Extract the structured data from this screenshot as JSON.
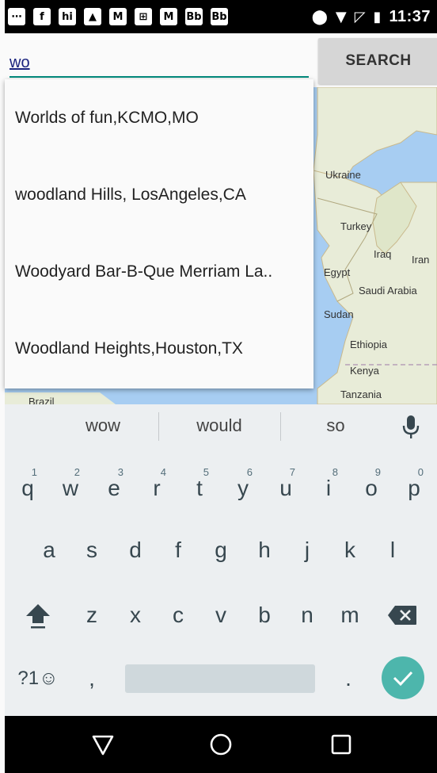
{
  "status_bar": {
    "time": "11:37",
    "icons": [
      "chat-bubble-icon",
      "facebook-icon",
      "hi-icon",
      "image-icon",
      "gmail-icon",
      "calculator-icon",
      "gmail-icon",
      "blackboard-icon",
      "blackboard-icon",
      "location-icon",
      "wifi-icon",
      "no-signal-icon",
      "battery-charging-icon"
    ]
  },
  "search": {
    "value": "wo",
    "button_label": "SEARCH"
  },
  "autocomplete": {
    "items": [
      "Worlds of fun,KCMO,MO",
      "woodland Hills, LosAngeles,CA",
      "Woodyard Bar-B-Que Merriam La..",
      "Woodland Heights,Houston,TX"
    ]
  },
  "map": {
    "labels": {
      "ukraine": "Ukraine",
      "turkey": "Turkey",
      "iraq": "Iraq",
      "iran": "Iran",
      "egypt": "Egypt",
      "saudi_arabia": "Saudi Arabia",
      "sudan": "Sudan",
      "ethiopia": "Ethiopia",
      "kenya": "Kenya",
      "tanzania": "Tanzania",
      "brazil": "Brazil"
    }
  },
  "keyboard": {
    "suggestions": [
      "wow",
      "would",
      "so"
    ],
    "row1": [
      {
        "letter": "q",
        "hint": "1"
      },
      {
        "letter": "w",
        "hint": "2"
      },
      {
        "letter": "e",
        "hint": "3"
      },
      {
        "letter": "r",
        "hint": "4"
      },
      {
        "letter": "t",
        "hint": "5"
      },
      {
        "letter": "y",
        "hint": "6"
      },
      {
        "letter": "u",
        "hint": "7"
      },
      {
        "letter": "i",
        "hint": "8"
      },
      {
        "letter": "o",
        "hint": "9"
      },
      {
        "letter": "p",
        "hint": "0"
      }
    ],
    "row2": [
      "a",
      "s",
      "d",
      "f",
      "g",
      "h",
      "j",
      "k",
      "l"
    ],
    "row3": [
      "z",
      "x",
      "c",
      "v",
      "b",
      "n",
      "m"
    ],
    "symbols_label": "?1☺",
    "comma_label": ",",
    "period_label": "."
  }
}
